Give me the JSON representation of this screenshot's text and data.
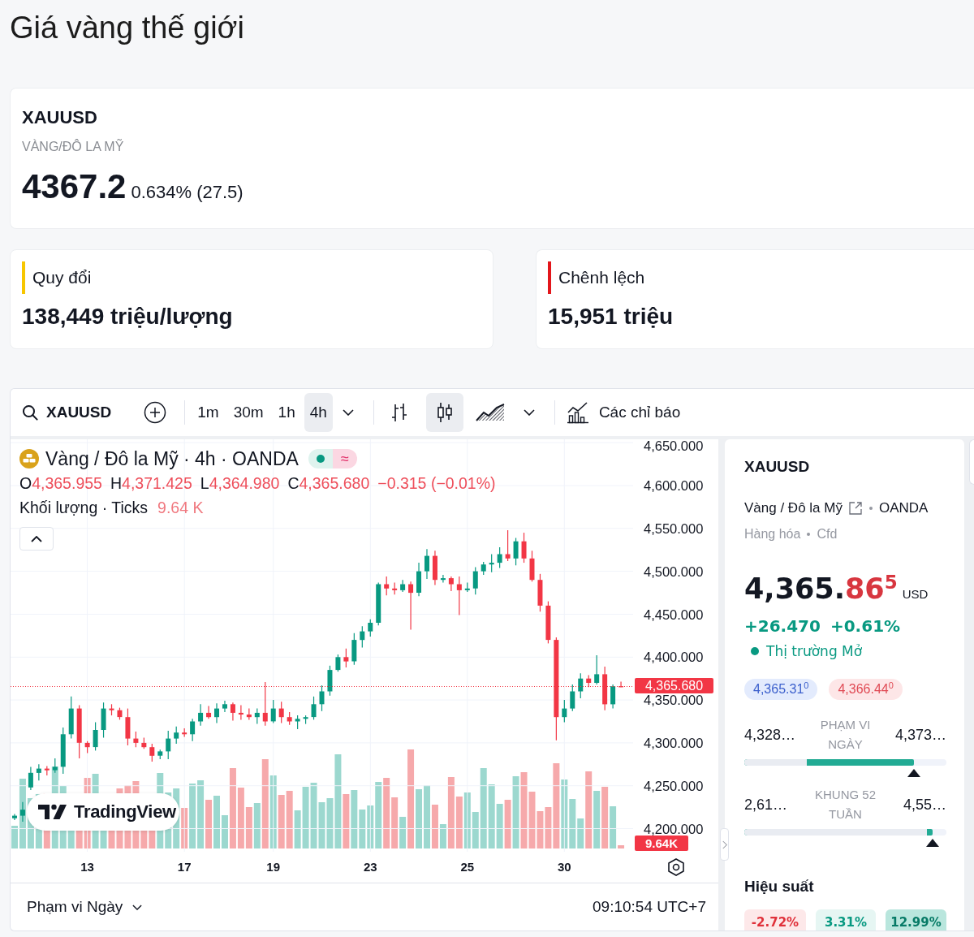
{
  "page_title": "Giá vàng thế giới",
  "quote_card": {
    "symbol": "XAUUSD",
    "name": "VÀNG/ĐÔ LA MỸ",
    "price": "4367.2",
    "change": "0.634% (27.5)"
  },
  "summary_cards": [
    {
      "label": "Quy đổi",
      "value": "138,449 triệu/lượng",
      "color": "#f7c600"
    },
    {
      "label": "Chênh lệch",
      "value": "15,951 triệu",
      "color": "#e3161b"
    }
  ],
  "chart_widget": {
    "toolbar": {
      "symbol": "XAUUSD",
      "intervals": [
        {
          "label": "1m",
          "selected": false
        },
        {
          "label": "30m",
          "selected": false
        },
        {
          "label": "1h",
          "selected": false
        },
        {
          "label": "4h",
          "selected": true
        }
      ],
      "chart_types": [
        {
          "kind": "bars",
          "selected": false
        },
        {
          "kind": "candles",
          "selected": true
        },
        {
          "kind": "area",
          "selected": false
        }
      ],
      "indicators_label": "Các chỉ báo"
    },
    "legend": {
      "title": "Vàng / Đô la Mỹ · 4h · OANDA",
      "delay_mark": "≈",
      "ohlc": [
        {
          "label": "O",
          "value": "4,365.955"
        },
        {
          "label": "H",
          "value": "4,371.425"
        },
        {
          "label": "L",
          "value": "4,364.980"
        },
        {
          "label": "C",
          "value": "4,365.680"
        }
      ],
      "change": "−0.315 (−0.01%)",
      "volume_label": "Khối lượng · Ticks",
      "volume_value": "9.64 K"
    },
    "logo_text": "TradingView",
    "chart_data": {
      "type": "candlestick",
      "categories": [
        null,
        null,
        null,
        null,
        null,
        null,
        null,
        null,
        null,
        "13",
        null,
        null,
        null,
        null,
        null,
        null,
        null,
        null,
        null,
        null,
        null,
        "17",
        null,
        null,
        null,
        null,
        null,
        null,
        null,
        null,
        null,
        null,
        "19",
        null,
        null,
        null,
        null,
        null,
        null,
        null,
        null,
        null,
        null,
        null,
        "23",
        null,
        null,
        null,
        null,
        null,
        null,
        null,
        null,
        null,
        null,
        null,
        "25",
        null,
        null,
        null,
        null,
        null,
        null,
        null,
        null,
        null,
        null,
        null,
        "30",
        null,
        null,
        null,
        null,
        null,
        null,
        null
      ],
      "ohlc": [
        [
          4212,
          4217,
          4210,
          4215
        ],
        [
          4215,
          4231,
          4208,
          4222
        ],
        [
          4248,
          4272,
          4245,
          4265
        ],
        [
          4265,
          4275,
          4256,
          4270
        ],
        [
          4270,
          4273,
          4262,
          4268
        ],
        [
          4268,
          4282,
          4265,
          4272
        ],
        [
          4272,
          4318,
          4264,
          4310
        ],
        [
          4310,
          4354,
          4305,
          4340
        ],
        [
          4340,
          4344,
          4282,
          4300
        ],
        [
          4300,
          4302,
          4288,
          4295
        ],
        [
          4295,
          4324,
          4291,
          4315
        ],
        [
          4315,
          4347,
          4306,
          4340
        ],
        [
          4340,
          4345,
          4332,
          4338
        ],
        [
          4338,
          4341,
          4327,
          4330
        ],
        [
          4330,
          4340,
          4297,
          4305
        ],
        [
          4305,
          4313,
          4295,
          4300
        ],
        [
          4300,
          4306,
          4293,
          4295
        ],
        [
          4295,
          4299,
          4278,
          4285
        ],
        [
          4285,
          4292,
          4281,
          4290
        ],
        [
          4290,
          4314,
          4281,
          4305
        ],
        [
          4305,
          4319,
          4299,
          4312
        ],
        [
          4312,
          4317,
          4307,
          4310
        ],
        [
          4310,
          4328,
          4302,
          4325
        ],
        [
          4325,
          4345,
          4320,
          4335
        ],
        [
          4335,
          4343,
          4328,
          4330
        ],
        [
          4330,
          4346,
          4323,
          4340
        ],
        [
          4340,
          4349,
          4336,
          4345
        ],
        [
          4345,
          4347,
          4326,
          4335
        ],
        [
          4335,
          4344,
          4327,
          4333
        ],
        [
          4333,
          4340,
          4327,
          4330
        ],
        [
          4330,
          4340,
          4322,
          4335
        ],
        [
          4335,
          4371,
          4320,
          4325
        ],
        [
          4325,
          4350,
          4323,
          4340
        ],
        [
          4340,
          4348,
          4323,
          4330
        ],
        [
          4330,
          4336,
          4321,
          4325
        ],
        [
          4325,
          4332,
          4316,
          4328
        ],
        [
          4328,
          4332,
          4322,
          4330
        ],
        [
          4330,
          4354,
          4327,
          4345
        ],
        [
          4345,
          4367,
          4337,
          4360
        ],
        [
          4360,
          4390,
          4355,
          4385
        ],
        [
          4385,
          4403,
          4383,
          4400
        ],
        [
          4400,
          4410,
          4388,
          4395
        ],
        [
          4395,
          4428,
          4391,
          4420
        ],
        [
          4420,
          4436,
          4411,
          4430
        ],
        [
          4430,
          4444,
          4424,
          4440
        ],
        [
          4440,
          4487,
          4437,
          4485
        ],
        [
          4485,
          4494,
          4472,
          4480
        ],
        [
          4480,
          4487,
          4473,
          4478
        ],
        [
          4478,
          4490,
          4476,
          4485
        ],
        [
          4485,
          4488,
          4432,
          4475
        ],
        [
          4475,
          4510,
          4471,
          4500
        ],
        [
          4500,
          4526,
          4491,
          4518
        ],
        [
          4518,
          4524,
          4484,
          4490
        ],
        [
          4490,
          4496,
          4487,
          4492
        ],
        [
          4492,
          4494,
          4477,
          4485
        ],
        [
          4485,
          4494,
          4449,
          4478
        ],
        [
          4478,
          4487,
          4476,
          4480
        ],
        [
          4480,
          4505,
          4473,
          4500
        ],
        [
          4500,
          4511,
          4496,
          4508
        ],
        [
          4508,
          4520,
          4499,
          4510
        ],
        [
          4510,
          4528,
          4504,
          4520
        ],
        [
          4520,
          4548,
          4512,
          4515
        ],
        [
          4515,
          4539,
          4507,
          4535
        ],
        [
          4535,
          4545,
          4510,
          4515
        ],
        [
          4515,
          4524,
          4488,
          4490
        ],
        [
          4490,
          4497,
          4453,
          4460
        ],
        [
          4460,
          4465,
          4416,
          4420
        ],
        [
          4420,
          4423,
          4303,
          4330
        ],
        [
          4330,
          4350,
          4324,
          4340
        ],
        [
          4340,
          4368,
          4337,
          4360
        ],
        [
          4360,
          4381,
          4352,
          4375
        ],
        [
          4375,
          4379,
          4365,
          4370
        ],
        [
          4370,
          4402,
          4368,
          4380
        ],
        [
          4380,
          4389,
          4338,
          4345
        ],
        [
          4345,
          4368,
          4340,
          4366
        ],
        [
          4365.955,
          4371.425,
          4364.98,
          4365.68
        ]
      ],
      "ylim": [
        4173,
        4654
      ],
      "yticks": [
        {
          "value": 4650,
          "label": "4,650.000"
        },
        {
          "value": 4600,
          "label": "4,600.000"
        },
        {
          "value": 4550,
          "label": "4,550.000"
        },
        {
          "value": 4500,
          "label": "4,500.000"
        },
        {
          "value": 4450,
          "label": "4,450.000"
        },
        {
          "value": 4400,
          "label": "4,400.000"
        },
        {
          "value": 4350,
          "label": "4,350.000"
        },
        {
          "value": 4300,
          "label": "4,300.000"
        },
        {
          "value": 4250,
          "label": "4,250.000"
        },
        {
          "value": 4200,
          "label": "4,200.000"
        }
      ],
      "grid": true,
      "ref_lines": [
        {
          "axis": "y",
          "value": 4365.68,
          "label": "4,365.680",
          "color": "#f23645"
        }
      ]
    },
    "volume_tag": "9.64K",
    "range_selector": "Phạm vi Ngày",
    "clock": "09:10:54 UTC+7"
  },
  "details_panel": {
    "symbol": "XAUUSD",
    "name": "Vàng / Đô la Mỹ",
    "exchange": "OANDA",
    "category": "Hàng hóa",
    "type": "Cfd",
    "price": {
      "main": "4,365.",
      "decimals": "86",
      "pip": "5",
      "currency": "USD"
    },
    "change": "+26.470",
    "change_percent": "+0.61%",
    "market_status": "Thị trường Mở",
    "bid": "4,365.31$^{0}$",
    "ask": "4,366.44$^{0}$",
    "ranges": [
      {
        "low": "4,328…",
        "label": "PHẠM VI NGÀY",
        "high": "4,373…",
        "fill_from": {
          "level": 0.31
        },
        "fill_to": {
          "level": 0.84
        }
      },
      {
        "low": "2,61…",
        "label": "KHUNG 52 TUẦN",
        "high": "4,55…",
        "fill_from": {
          "level": 0.905
        },
        "fill_to": {
          "level": 0.93
        }
      }
    ],
    "performance_title": "Hiệu suất",
    "performance": [
      {
        "value": "-2.72%",
        "kind": "down"
      },
      {
        "value": "3.31%",
        "kind": "up"
      },
      {
        "value": "12.99%",
        "kind": "up-strong"
      }
    ]
  }
}
